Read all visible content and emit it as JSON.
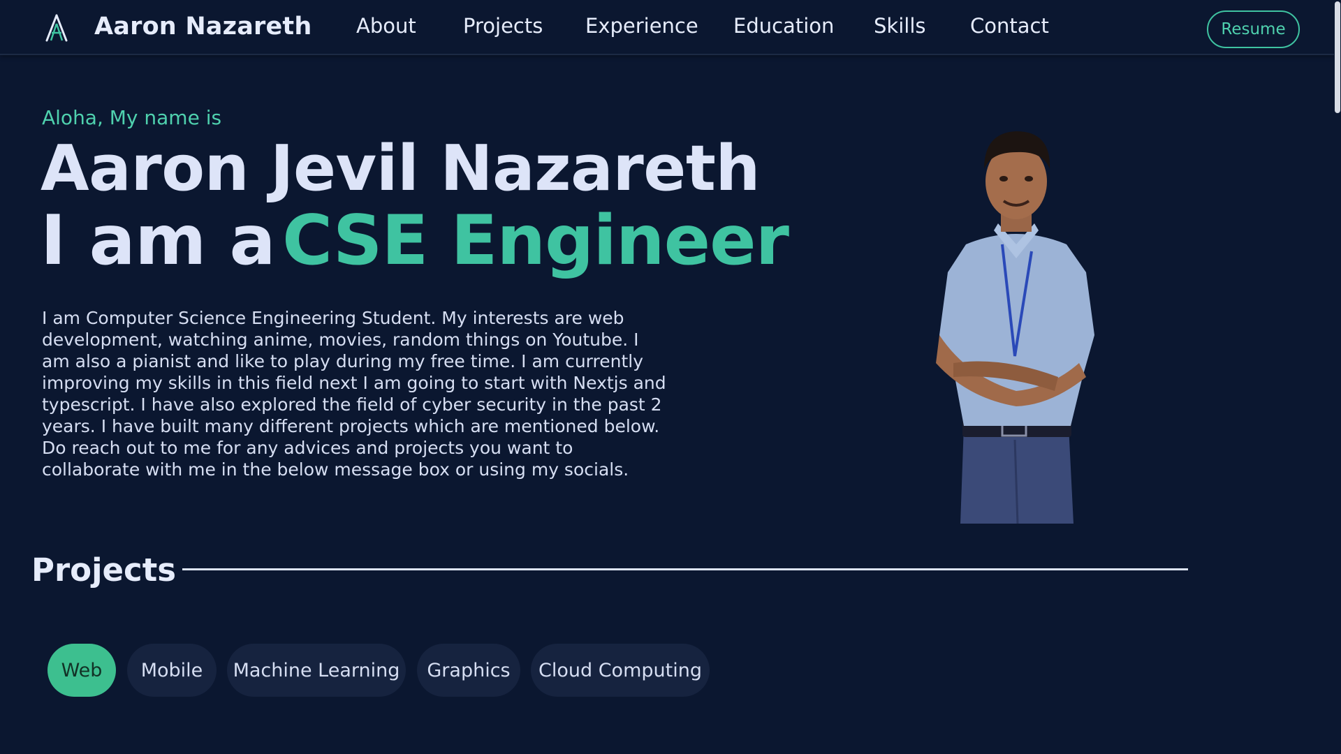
{
  "nav": {
    "brand": "Aaron Nazareth",
    "links": [
      "About",
      "Projects",
      "Experience",
      "Education",
      "Skills",
      "Contact"
    ],
    "resume_label": "Resume"
  },
  "hero": {
    "greeting": "Aloha, My name is",
    "name": "Aaron Jevil Nazareth",
    "role_prefix": "I am a",
    "role_highlight": "CSE Engineer",
    "bio": "I am Computer Science Engineering Student. My interests are web development, watching anime, movies, random things on Youtube. I am also a pianist and like to play during my free time. I am currently improving my skills in this field next I am going to start with Nextjs and typescript. I have also explored the field of cyber security in the past 2 years. I have built many different projects which are mentioned below. Do reach out to me for any advices and projects you want to collaborate with me in the below message box or using my socials."
  },
  "projects": {
    "title": "Projects",
    "filters": [
      "Web",
      "Mobile",
      "Machine Learning",
      "Graphics",
      "Cloud Computing"
    ],
    "active_filter": "Web"
  },
  "colors": {
    "background": "#0b1730",
    "accent": "#3fc3a1",
    "text": "#dde4f8",
    "chip": "#16233f",
    "chip_active": "#3dbf8f"
  },
  "icons": {
    "logo": "a-letter-logo-icon"
  }
}
